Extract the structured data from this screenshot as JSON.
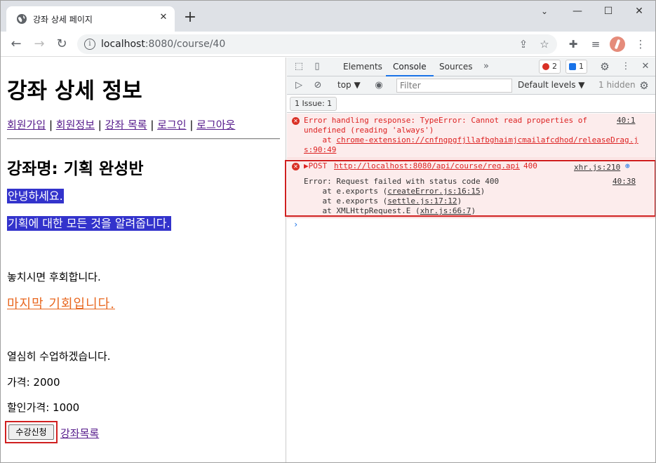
{
  "browser": {
    "tab_title": "강좌 상세 페이지",
    "tab_close": "✕",
    "new_tab": "+",
    "url_host": "localhost",
    "url_rest": ":8080/course/40",
    "window_controls": {
      "minimize": "—",
      "maximize": "☐",
      "close": "✕"
    }
  },
  "page": {
    "heading": "강좌 상세 정보",
    "nav": [
      {
        "label": "회원가입"
      },
      {
        "label": "회원정보"
      },
      {
        "label": "강좌 목록"
      },
      {
        "label": "로그인"
      },
      {
        "label": "로그아웃"
      }
    ],
    "nav_sep": " | ",
    "course_name": "강좌명: 기획 완성반",
    "desc_line1": "안녕하세요.",
    "desc_line2": "기획에 대한 모든 것을 알려줍니다.",
    "desc_line3": "놓치시면 후회합니다.",
    "desc_line4": "마지막 기회입니다.",
    "desc_line5": "열심히 수업하겠습니다.",
    "price": "가격: 2000",
    "sale_price": "할인가격: 1000",
    "enroll_button": "수강신청",
    "course_list_link": "강좌목록",
    "highlight_color": "#3333cc",
    "accent_text_color": "#e8671f"
  },
  "devtools": {
    "tabs": [
      "Elements",
      "Console",
      "Sources"
    ],
    "active_tab": "Console",
    "more_tabs": "»",
    "error_count": "2",
    "message_count": "1",
    "context": "top ▼",
    "filter_placeholder": "Filter",
    "levels": "Default levels ▼",
    "hidden": "1 hidden",
    "issues": "1 Issue:  1",
    "err1": {
      "line1": "Error handling response: TypeError: Cannot read properties of",
      "line2": "undefined (reading 'always')",
      "line3_prefix": "    at ",
      "line3_link": "chrome-extension://cnfngpgfjllafbghaimjcmailafcdhod/releaseDrag.j",
      "line4": "s:90:49",
      "source": "40:1"
    },
    "err2": {
      "method": "▶POST",
      "url": "http://localhost:8080/api/course/req.api",
      "status": "400",
      "source": "xhr.js:210",
      "detail1": "Error: Request failed with status code 400",
      "detail_source": "40:38",
      "stack1_prefix": "    at e.exports (",
      "stack1_link": "createError.js:16:15",
      "stack2_prefix": "    at e.exports (",
      "stack2_link": "settle.js:17:12",
      "stack3_prefix": "    at XMLHttpRequest.E (",
      "stack3_link": "xhr.js:66:7",
      "close_paren": ")"
    },
    "prompt": "›"
  }
}
